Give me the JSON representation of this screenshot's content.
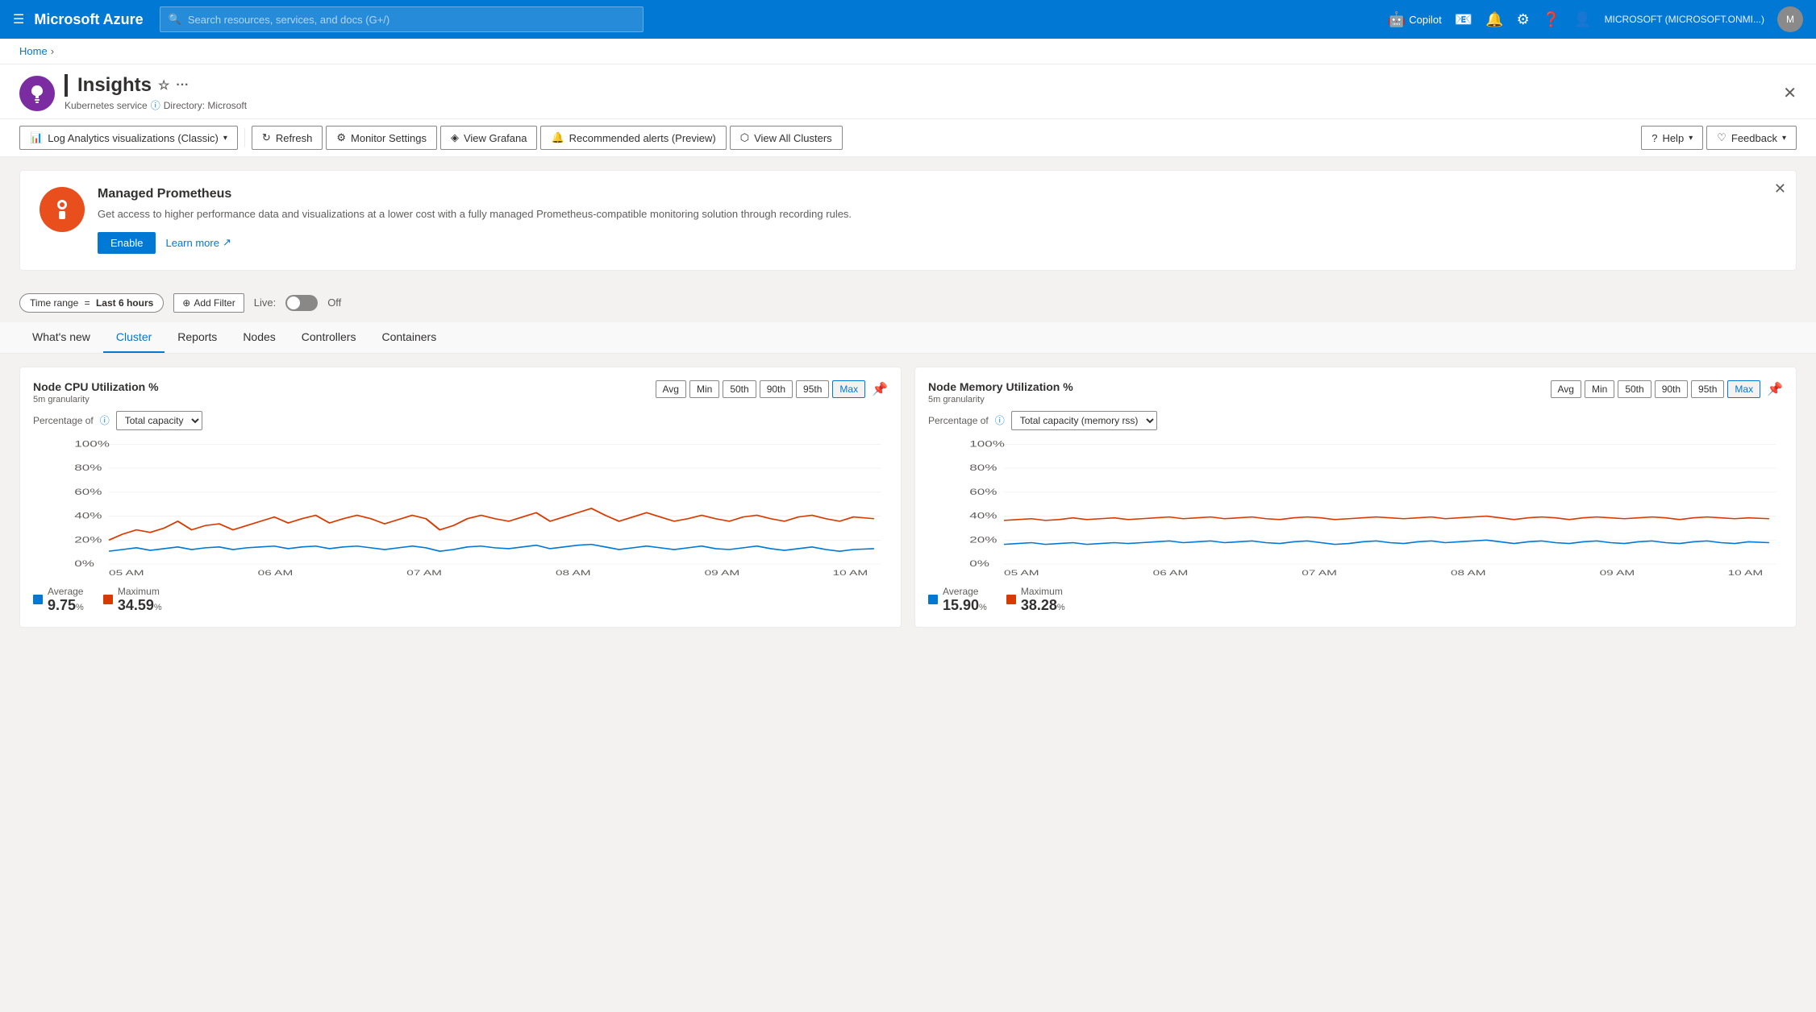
{
  "topnav": {
    "hamburger": "☰",
    "brand": "Microsoft Azure",
    "search_placeholder": "Search resources, services, and docs (G+/)",
    "copilot_label": "Copilot",
    "account": "MICROSOFT (MICROSOFT.ONMI...)",
    "icons": [
      "📧",
      "🔔",
      "⚙",
      "❓",
      "👤"
    ]
  },
  "breadcrumb": {
    "home": "Home",
    "sep": "›"
  },
  "page": {
    "icon": "🔥",
    "title": "Insights",
    "service": "Kubernetes service",
    "directory": "Directory: Microsoft",
    "info_icon": "ⓘ"
  },
  "toolbar": {
    "analytics_label": "Log Analytics visualizations (Classic)",
    "refresh": "Refresh",
    "monitor_settings": "Monitor Settings",
    "view_grafana": "View Grafana",
    "recommended_alerts": "Recommended alerts (Preview)",
    "view_all_clusters": "View All Clusters",
    "help": "Help",
    "feedback": "Feedback"
  },
  "banner": {
    "title": "Managed Prometheus",
    "description": "Get access to higher performance data and visualizations at a lower cost with a fully managed Prometheus-compatible monitoring solution through recording rules.",
    "enable_label": "Enable",
    "learn_more": "Learn more"
  },
  "filters": {
    "time_range_label": "Time range",
    "time_range_value": "Last 6 hours",
    "add_filter_label": "Add Filter",
    "live_label": "Live:",
    "off_label": "Off"
  },
  "tabs": [
    {
      "id": "whats-new",
      "label": "What's new"
    },
    {
      "id": "cluster",
      "label": "Cluster",
      "active": true
    },
    {
      "id": "reports",
      "label": "Reports"
    },
    {
      "id": "nodes",
      "label": "Nodes"
    },
    {
      "id": "controllers",
      "label": "Controllers"
    },
    {
      "id": "containers",
      "label": "Containers"
    }
  ],
  "cpu_chart": {
    "title": "Node CPU Utilization %",
    "subtitle": "5m granularity",
    "buttons": [
      "Avg",
      "Min",
      "50th",
      "90th",
      "95th",
      "Max"
    ],
    "active_btn": "Max",
    "percentage_of_label": "Percentage of",
    "dropdown_value": "Total capacity",
    "x_labels": [
      "05 AM",
      "06 AM",
      "07 AM",
      "08 AM",
      "09 AM",
      "10 AM"
    ],
    "y_labels": [
      "100%",
      "80%",
      "60%",
      "40%",
      "20%",
      "0%"
    ],
    "legend": [
      {
        "color": "#0078d4",
        "label": "Average",
        "value": "9.75",
        "unit": "%"
      },
      {
        "color": "#d83b01",
        "label": "Maximum",
        "value": "34.59",
        "unit": "%"
      }
    ]
  },
  "memory_chart": {
    "title": "Node Memory Utilization %",
    "subtitle": "5m granularity",
    "buttons": [
      "Avg",
      "Min",
      "50th",
      "90th",
      "95th",
      "Max"
    ],
    "active_btn": "Max",
    "percentage_of_label": "Percentage of",
    "dropdown_value": "Total capacity (memory rss)",
    "x_labels": [
      "05 AM",
      "06 AM",
      "07 AM",
      "08 AM",
      "09 AM",
      "10 AM"
    ],
    "y_labels": [
      "100%",
      "80%",
      "60%",
      "40%",
      "20%",
      "0%"
    ],
    "legend": [
      {
        "color": "#0078d4",
        "label": "Average",
        "value": "15.90",
        "unit": "%"
      },
      {
        "color": "#d83b01",
        "label": "Maximum",
        "value": "38.28",
        "unit": "%"
      }
    ]
  }
}
